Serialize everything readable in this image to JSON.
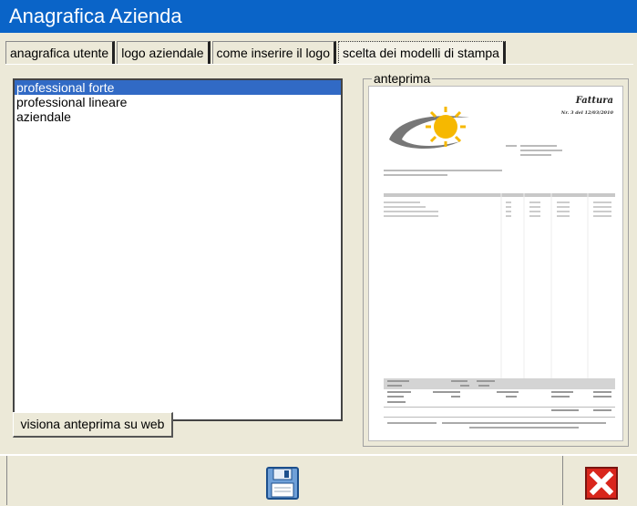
{
  "window": {
    "title": "Anagrafica Azienda"
  },
  "tabs": [
    {
      "label": "anagrafica utente"
    },
    {
      "label": "logo aziendale"
    },
    {
      "label": "come inserire il logo"
    },
    {
      "label": "scelta dei modelli di stampa"
    }
  ],
  "templates": {
    "items": [
      {
        "label": "professional forte"
      },
      {
        "label": "professional lineare"
      },
      {
        "label": "aziendale"
      }
    ],
    "selected": "professional forte"
  },
  "web_preview_button": {
    "label": "visiona anteprima su web"
  },
  "preview": {
    "group_label": "anteprima",
    "doc_title": "Fattura",
    "doc_number": "Nr. 3 del 12/03/2010"
  },
  "icons": {
    "save": "floppy-disk-icon",
    "close": "close-icon"
  },
  "colors": {
    "titlebar": "#0a64c8",
    "selection": "#316ac5",
    "close_red": "#d9261c"
  }
}
